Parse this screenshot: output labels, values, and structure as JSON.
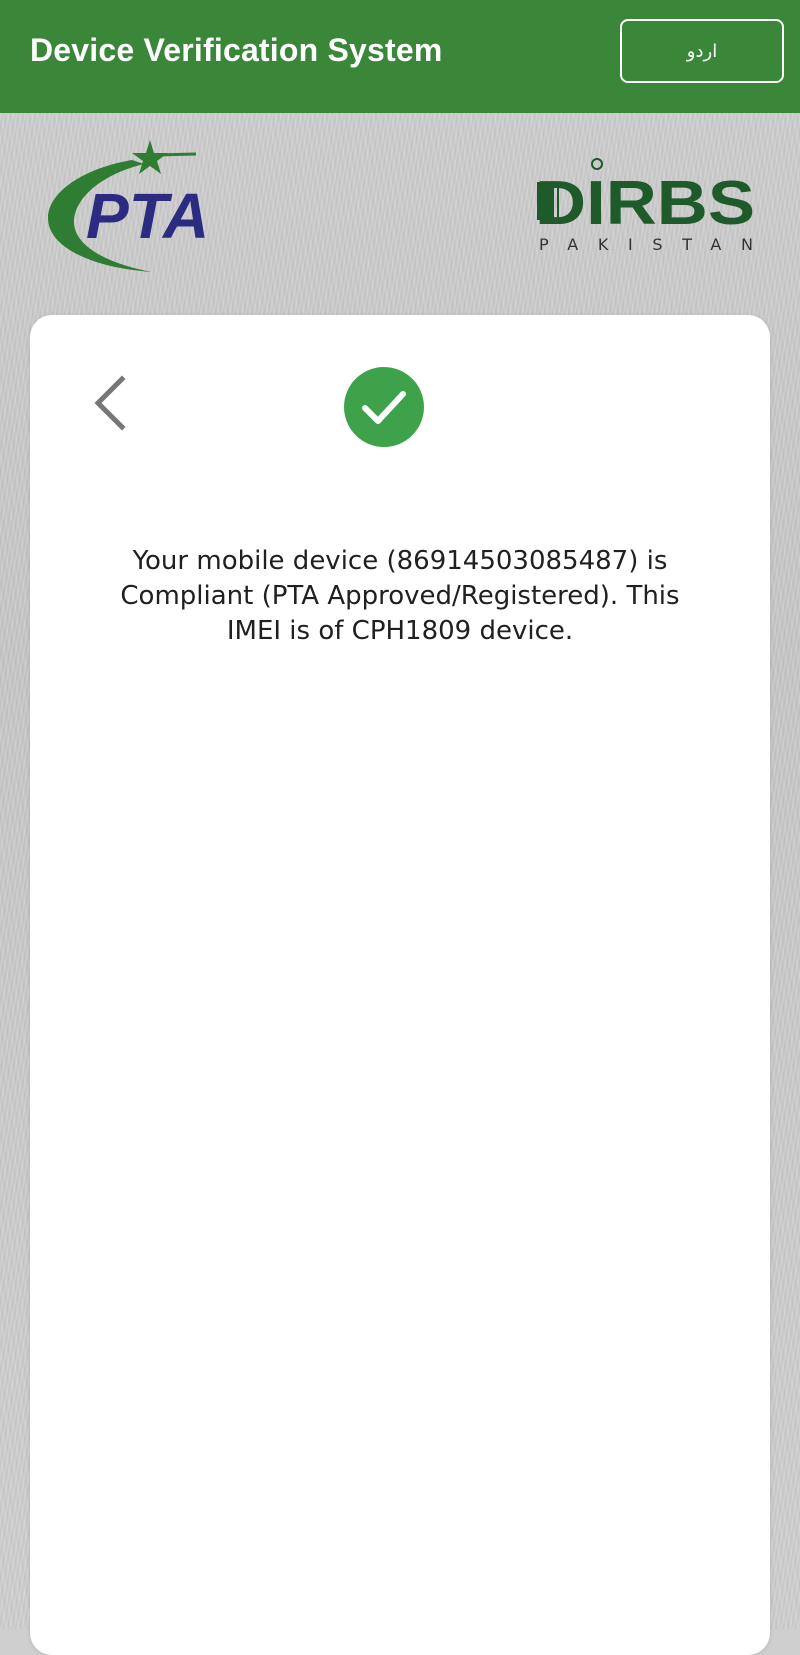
{
  "header": {
    "title": "Device Verification System",
    "language_button_label": "اردو"
  },
  "logos": {
    "pta_text": "PTA",
    "dirbs_text": "DIRBS",
    "dirbs_subtext": "PAKISTAN"
  },
  "result": {
    "message": "Your mobile device (86914503085487) is Compliant (PTA Approved/Registered). This IMEI is of CPH1809 device."
  },
  "colors": {
    "header_green": "#3b873a",
    "pta_blue": "#2b2b82",
    "pta_green": "#2f7d32",
    "dirbs_green": "#1f5a2a",
    "success_green": "#3da24a"
  },
  "icons": {
    "back": "chevron-left-icon",
    "status": "check-circle-icon"
  }
}
